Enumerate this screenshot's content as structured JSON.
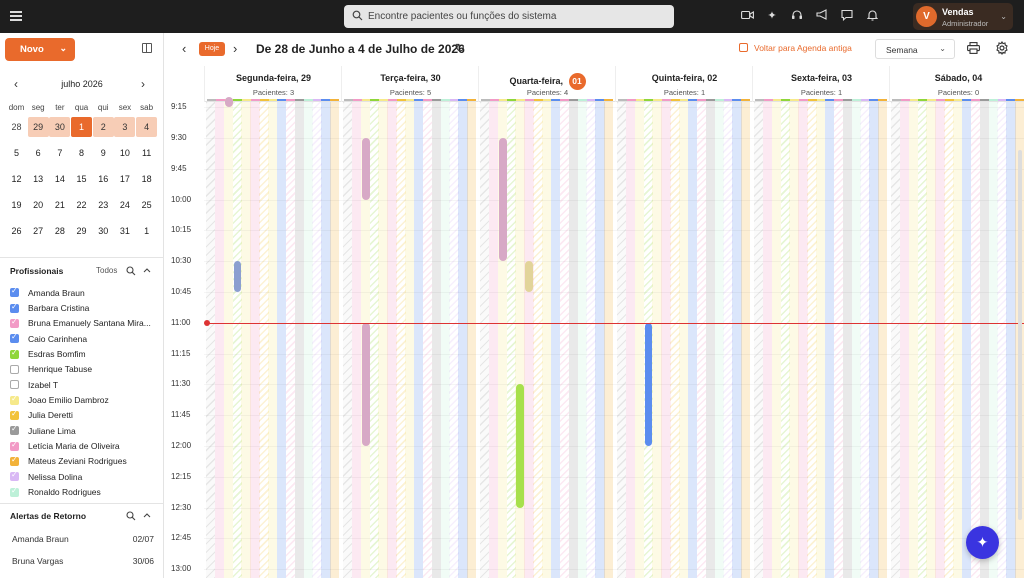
{
  "topbar": {
    "search_placeholder": "Encontre pacientes ou funções do sistema",
    "icons": [
      "video-icon",
      "sparkle-icon",
      "headset-icon",
      "megaphone-icon",
      "chat-icon",
      "bell-icon"
    ],
    "user": {
      "initial": "V",
      "name": "Vendas",
      "role": "Administrador"
    }
  },
  "sidebar": {
    "new_label": "Novo",
    "mini_calendar": {
      "title": "julho 2026",
      "weekdays": [
        "dom",
        "seg",
        "ter",
        "qua",
        "qui",
        "sex",
        "sab"
      ],
      "weeks": [
        [
          "28",
          "29",
          "30",
          "1",
          "2",
          "3",
          "4"
        ],
        [
          "5",
          "6",
          "7",
          "8",
          "9",
          "10",
          "11"
        ],
        [
          "12",
          "13",
          "14",
          "15",
          "16",
          "17",
          "18"
        ],
        [
          "19",
          "20",
          "21",
          "22",
          "23",
          "24",
          "25"
        ],
        [
          "26",
          "27",
          "28",
          "29",
          "30",
          "31",
          "1"
        ]
      ]
    },
    "professionals_title": "Profissionais",
    "professionals_all": "Todos",
    "professionals": [
      {
        "name": "Amanda Braun",
        "color": "#5b8def",
        "checked": true
      },
      {
        "name": "Barbara Cristina",
        "color": "#5b8def",
        "checked": true
      },
      {
        "name": "Bruna Emanuely Santana Mira...",
        "color": "#f29ac6",
        "checked": true
      },
      {
        "name": "Caio Carinhena",
        "color": "#5b8def",
        "checked": true
      },
      {
        "name": "Esdras Bomfim",
        "color": "#8fd63a",
        "checked": true
      },
      {
        "name": "Henrique Tabuse",
        "color": "#ffffff",
        "checked": false
      },
      {
        "name": "Izabel T",
        "color": "#ffffff",
        "checked": false
      },
      {
        "name": "Joao Emilio Dambroz",
        "color": "#f6e98a",
        "checked": true
      },
      {
        "name": "Julia Deretti",
        "color": "#f2c23a",
        "checked": true
      },
      {
        "name": "Juliane Lima",
        "color": "#9a9a9a",
        "checked": true
      },
      {
        "name": "Letícia Maria de Oliveira",
        "color": "#f29ac6",
        "checked": true
      },
      {
        "name": "Mateus Zeviani Rodrigues",
        "color": "#f2b23a",
        "checked": true
      },
      {
        "name": "Nelissa Dolina",
        "color": "#d9b8f5",
        "checked": true
      },
      {
        "name": "Ronaldo Rodrigues",
        "color": "#bdf0d8",
        "checked": true
      }
    ],
    "alerts_title": "Alertas de Retorno",
    "alerts": [
      {
        "name": "Amanda Braun",
        "date": "02/07"
      },
      {
        "name": "Bruna Vargas",
        "date": "30/06"
      }
    ]
  },
  "header": {
    "today_label": "Hoje",
    "range_title": "De 28 de Junho a 4 de Julho de 2026",
    "old_agenda_label": "Voltar para Agenda antiga",
    "view_selected": "Semana"
  },
  "week": {
    "days": [
      {
        "name": "Segunda-feira,",
        "num": "29",
        "patients": "Pacientes: 3",
        "today": false
      },
      {
        "name": "Terça-feira,",
        "num": "30",
        "patients": "Pacientes: 5",
        "today": false
      },
      {
        "name": "Quarta-feira,",
        "num": "01",
        "patients": "Pacientes: 4",
        "today": true
      },
      {
        "name": "Quinta-feira,",
        "num": "02",
        "patients": "Pacientes: 1",
        "today": false
      },
      {
        "name": "Sexta-feira,",
        "num": "03",
        "patients": "Pacientes: 1",
        "today": false
      },
      {
        "name": "Sábado,",
        "num": "04",
        "patients": "Pacientes: 0",
        "today": false
      }
    ],
    "times": [
      "9:15",
      "9:30",
      "9:45",
      "10:00",
      "10:15",
      "10:30",
      "10:45",
      "11:00",
      "11:15",
      "11:30",
      "11:45",
      "12:00",
      "12:15",
      "12:30",
      "12:45",
      "13:00"
    ],
    "lane_colors": [
      "#bbbbbb",
      "#f29ac6",
      "#f6e98a",
      "#8fd63a",
      "#f6e98a",
      "#f29ac6",
      "#f2c23a",
      "#f6e98a",
      "#5b8def",
      "#f29ac6",
      "#9a9a9a",
      "#bdf0d8",
      "#d9b8f5",
      "#5b8def",
      "#f2b23a"
    ],
    "now_time": "11:00",
    "events": [
      {
        "day": 0,
        "lane": 2,
        "start": "9:10",
        "end": "9:15",
        "color": "#d7a9c6"
      },
      {
        "day": 0,
        "lane": 3,
        "start": "10:30",
        "end": "10:45",
        "color": "#8b9fd0"
      },
      {
        "day": 1,
        "lane": 2,
        "start": "9:30",
        "end": "10:00",
        "color": "#d7a9c6"
      },
      {
        "day": 1,
        "lane": 2,
        "start": "11:00",
        "end": "12:00",
        "color": "#d7a9c6"
      },
      {
        "day": 2,
        "lane": 2,
        "start": "9:30",
        "end": "10:30",
        "color": "#d7a9c6"
      },
      {
        "day": 2,
        "lane": 5,
        "start": "10:30",
        "end": "10:45",
        "color": "#e2d49a"
      },
      {
        "day": 2,
        "lane": 4,
        "start": "11:30",
        "end": "12:30",
        "color": "#a7e04c"
      },
      {
        "day": 3,
        "lane": 3,
        "start": "11:00",
        "end": "12:00",
        "color": "#5b8def"
      }
    ]
  }
}
